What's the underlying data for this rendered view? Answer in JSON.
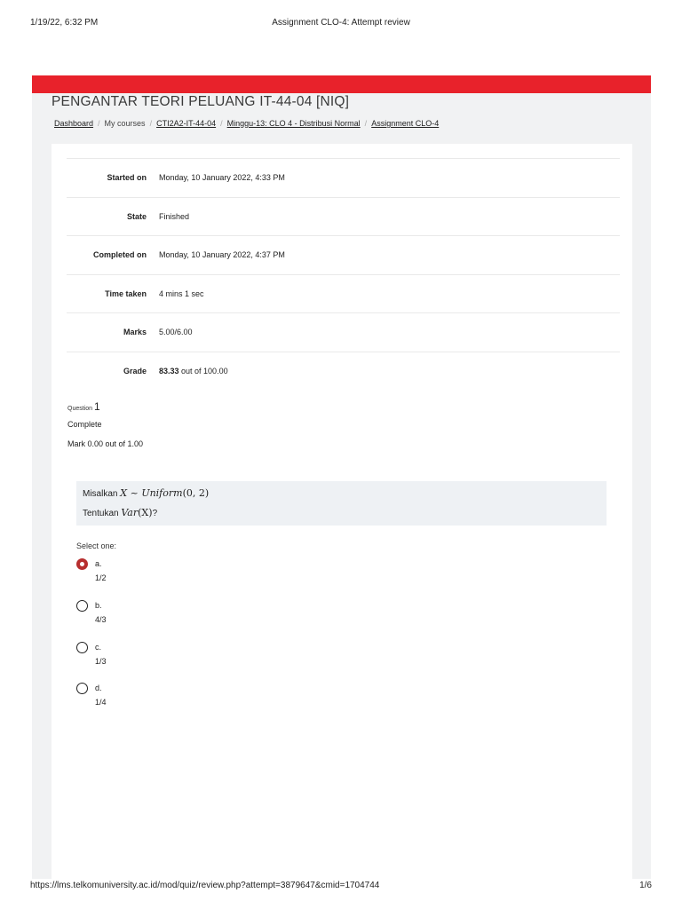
{
  "print_header": {
    "datetime": "1/19/22, 6:32 PM",
    "title": "Assignment CLO-4: Attempt review"
  },
  "print_footer": {
    "url": "https://lms.telkomuniversity.ac.id/mod/quiz/review.php?attempt=3879647&cmid=1704744",
    "page": "1/6"
  },
  "course_title": "PENGANTAR TEORI PELUANG IT-44-04 [NIQ]",
  "breadcrumb": [
    {
      "label": "Dashboard",
      "link": true
    },
    {
      "label": "My courses",
      "link": false
    },
    {
      "label": "CTI2A2-IT-44-04",
      "link": true
    },
    {
      "label": "Minggu-13: CLO 4 - Distribusi Normal",
      "link": true
    },
    {
      "label": "Assignment CLO-4",
      "link": true
    }
  ],
  "summary": [
    {
      "label": "Started on",
      "value": "Monday, 10 January 2022, 4:33 PM"
    },
    {
      "label": "State",
      "value": "Finished"
    },
    {
      "label": "Completed on",
      "value": "Monday, 10 January 2022, 4:37 PM"
    },
    {
      "label": "Time taken",
      "value": "4 mins 1 sec"
    },
    {
      "label": "Marks",
      "value": "5.00/6.00"
    },
    {
      "label": "Grade",
      "value_bold": "83.33",
      "value_rest": " out of 100.00"
    }
  ],
  "question": {
    "label": "Question",
    "number": "1",
    "state": "Complete",
    "grade": "Mark 0.00 out of 1.00",
    "text1_prefix": "Misalkan ",
    "text1_math": {
      "var": "X",
      "op": " ~ ",
      "dist": "Uniform",
      "args": "(0, 2)"
    },
    "text2_prefix": "Tentukan ",
    "text2_math": {
      "fn": "Var",
      "arg": "(X)"
    },
    "text2_suffix": "?",
    "prompt": "Select one:",
    "options": [
      {
        "letter": "a.",
        "answer": "1/2",
        "selected": true
      },
      {
        "letter": "b.",
        "answer": "4/3",
        "selected": false
      },
      {
        "letter": "c.",
        "answer": "1/3",
        "selected": false
      },
      {
        "letter": "d.",
        "answer": "1/4",
        "selected": false
      }
    ]
  },
  "colors": {
    "brand_red": "#e8222b",
    "selected_radio": "#b72f2f"
  }
}
